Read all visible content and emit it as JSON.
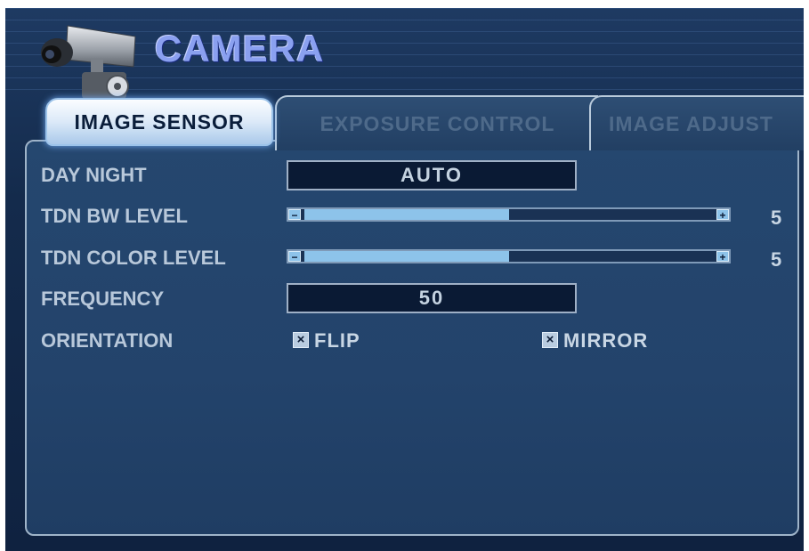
{
  "header": {
    "title": "CAMERA",
    "icon": "camera-icon"
  },
  "tabs": [
    {
      "label": "IMAGE SENSOR",
      "active": true
    },
    {
      "label": "EXPOSURE CONTROL",
      "active": false
    },
    {
      "label": "IMAGE ADJUST",
      "active": false
    }
  ],
  "settings": {
    "day_night": {
      "label": "DAY NIGHT",
      "value": "AUTO"
    },
    "tdn_bw_level": {
      "label": "TDN BW LEVEL",
      "value": "5",
      "level_fraction": 0.5,
      "minus": "−",
      "plus": "+"
    },
    "tdn_color_level": {
      "label": "TDN COLOR LEVEL",
      "value": "5",
      "level_fraction": 0.5,
      "minus": "−",
      "plus": "+"
    },
    "frequency": {
      "label": "FREQUENCY",
      "value": "50"
    },
    "orientation": {
      "label": "ORIENTATION",
      "flip": {
        "label": "FLIP",
        "checked": true,
        "mark": "×"
      },
      "mirror": {
        "label": "MIRROR",
        "checked": true,
        "mark": "×"
      }
    }
  },
  "colors": {
    "accent_title": "#8aa0f0",
    "panel_bg": "#23436b",
    "slider_fill": "#8dc3ea",
    "active_tab": "#dbe9f8"
  }
}
